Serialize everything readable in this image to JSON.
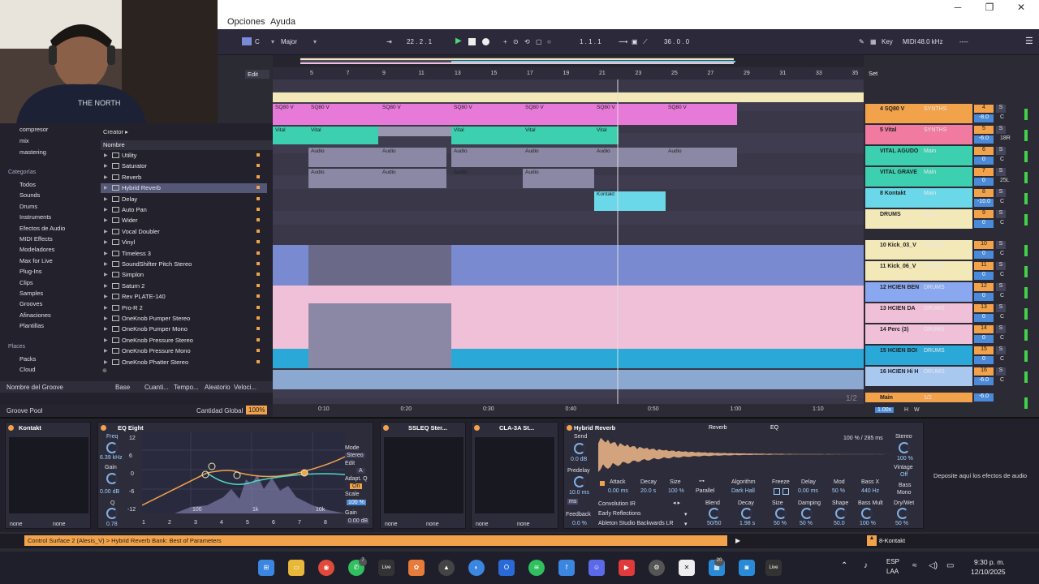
{
  "menu": {
    "opciones": "Opciones",
    "ayuda": "Ayuda"
  },
  "window_controls": {
    "min": "─",
    "max": "❐",
    "close": "✕"
  },
  "transport": {
    "key": "C",
    "scale": "Major",
    "position": "22 .  2 .  1",
    "loop_start": "1 .  1 .  1",
    "loop_len": "36 .  0 .  0",
    "key_label": "Key",
    "midi_label": "MIDI",
    "sample_rate": "48.0 kHz",
    "cpu": "----"
  },
  "browser": {
    "edit_label": "Edit",
    "places_top": [
      "compresor",
      "mix",
      "mastering"
    ],
    "categories_title": "Categorías",
    "categories": [
      "Todos",
      "Sounds",
      "Drums",
      "Instruments",
      "Efectos de Audio",
      "MIDI Effects",
      "Modeladores",
      "Max for Live",
      "Plug-Ins",
      "Clips",
      "Samples",
      "Grooves",
      "Afinaciones",
      "Plantillas"
    ],
    "places_title": "Places",
    "places": [
      "Packs",
      "Cloud"
    ],
    "creator": "Creator ▸",
    "nombre": "Nombre",
    "items": [
      "Utility",
      "Saturator",
      "Reverb",
      "Hybrid Reverb",
      "Delay",
      "Auto Pan",
      "Wider",
      "Vocal Doubler",
      "Vinyl",
      "Timeless 3",
      "SoundShifter Pitch Stereo",
      "Simplon",
      "Saturn 2",
      "Rev PLATE-140",
      "Pro-R 2",
      "OneKnob Pumper Stereo",
      "OneKnob Pumper Mono",
      "OneKnob Pressure Stereo",
      "OneKnob Pressure Mono",
      "OneKnob Phatter Stereo"
    ],
    "groove_cols": [
      "Nombre del Groove",
      "Base",
      "Cuanti...",
      "Tempo...",
      "Aleatorio",
      "Veloci..."
    ],
    "groove_pool": "Groove Pool",
    "cantidad_global": "Cantidad Global",
    "cantidad_value": "100%"
  },
  "ruler": {
    "bars": [
      "5",
      "7",
      "9",
      "11",
      "13",
      "15",
      "17",
      "19",
      "21",
      "23",
      "25",
      "27",
      "29",
      "31",
      "33",
      "35"
    ],
    "set_label": "Set"
  },
  "timeline": {
    "times": [
      "0:10",
      "0:20",
      "0:30",
      "0:40",
      "0:50",
      "1:00",
      "1:10"
    ],
    "page": "1/2"
  },
  "clips": {
    "sq80": "SQ80 V",
    "vital": "Vital",
    "audio": "Audio",
    "kontakt": "Kontakt"
  },
  "tracks": [
    {
      "name": "4 SQ80 V",
      "route": "SYNTHS",
      "num": "4",
      "vol": "-8.0",
      "pan": "C",
      "color": "#f2a24a"
    },
    {
      "name": "5 Vital",
      "route": "SYNTHS",
      "num": "5",
      "vol": "-6.0",
      "pan": "18R",
      "color": "#f07aa0"
    },
    {
      "name": "VITAL AGUDO",
      "route": "Main",
      "num": "6",
      "vol": "0",
      "pan": "C",
      "color": "#3ccfb0"
    },
    {
      "name": "VITAL GRAVE",
      "route": "Main",
      "num": "7",
      "vol": "0",
      "pan": "25L",
      "color": "#3ccfb0"
    },
    {
      "name": "8 Kontakt",
      "route": "Main",
      "num": "8",
      "vol": "-10.0",
      "pan": "C",
      "color": "#6ad8e8"
    },
    {
      "name": "DRUMS",
      "route": "Main",
      "num": "9",
      "vol": "0",
      "pan": "C",
      "color": "#f2e8b8"
    },
    {
      "name": "10 Kick_03_V",
      "route": "DRUMS",
      "num": "10",
      "vol": "0",
      "pan": "C",
      "color": "#f2e8b8"
    },
    {
      "name": "11 Kick_06_V",
      "route": "DRUMS",
      "num": "11",
      "vol": "0",
      "pan": "C",
      "color": "#f2e8b8"
    },
    {
      "name": "12 HCIEN BEN",
      "route": "DRUMS",
      "num": "12",
      "vol": "0",
      "pan": "C",
      "color": "#8aa8f0"
    },
    {
      "name": "13 HCIEN DA",
      "route": "DRUMS",
      "num": "13",
      "vol": "0",
      "pan": "C",
      "color": "#f0c0d8"
    },
    {
      "name": "14 Perc (3)",
      "route": "DRUMS",
      "num": "14",
      "vol": "0",
      "pan": "C",
      "color": "#f0c0d8"
    },
    {
      "name": "15 HCIEN BOI",
      "route": "DRUMS",
      "num": "15",
      "vol": "0",
      "pan": "C",
      "color": "#2aa8d8"
    },
    {
      "name": "16 HCIEN Hi H",
      "route": "DRUMS",
      "num": "16",
      "vol": "-6.0",
      "pan": "C",
      "color": "#a8c8f0"
    },
    {
      "name": "Main",
      "route": "1/2",
      "num": "",
      "vol": "-6.0",
      "pan": "",
      "color": "#f2a24a"
    }
  ],
  "main_extra": {
    "zoom": "1.00x",
    "h": "H",
    "w": "W"
  },
  "devices": {
    "kontakt": {
      "title": "Kontakt",
      "none1": "none",
      "none2": "none"
    },
    "eq": {
      "title": "EQ Eight",
      "freq": "Freq",
      "freq_val": "6.39 kHz",
      "gain": "Gain",
      "gain_val": "0.00 dB",
      "q": "Q",
      "q_val": "0.78",
      "db": [
        "12",
        "6",
        "0",
        "-6",
        "-12"
      ],
      "mode": "Mode",
      "mode_val": "Stereo",
      "edit": "Edit",
      "edit_val": "A",
      "adapt": "Adapt. Q",
      "adapt_val": "On",
      "scale": "Scale",
      "scale_val": "100 %",
      "gain2": "Gain",
      "gain2_val": "0.00 dB",
      "freq_labels": [
        "100",
        "1k",
        "10k"
      ],
      "bands": [
        "1",
        "2",
        "3",
        "4",
        "5",
        "6",
        "7",
        "8"
      ]
    },
    "ssleq": {
      "title": "SSLEQ Ster...",
      "none1": "none",
      "none2": "none"
    },
    "cla": {
      "title": "CLA-3A St...",
      "none1": "none",
      "none2": "none"
    },
    "hybrid": {
      "title": "Hybrid Reverb",
      "tab_reverb": "Reverb",
      "tab_eq": "EQ",
      "send": "Send",
      "send_val": "0.0 dB",
      "predelay": "Predelay",
      "predelay_val": "10.0 ms",
      "ms": "ms",
      "feedback": "Feedback",
      "feedback_val": "0.0 %",
      "ir_readout": "100 % / 285 ms",
      "attack": "Attack",
      "attack_val": "0.00 ms",
      "decay": "Decay",
      "decay_val": "20.0 s",
      "size": "Size",
      "size_val": "100 %",
      "parallel": "Parallel",
      "algorithm": "Algorithm",
      "algorithm_val": "Dark Hall",
      "freeze": "Freeze",
      "delay": "Delay",
      "delay_val": "0.00 ms",
      "mod": "Mod",
      "mod_val": "50 %",
      "bassx": "Bass X",
      "bassx_val": "440 Hz",
      "conv": "Convolution IR",
      "early": "Early Reflections",
      "ir_name": "Ableton Studio Backwards LR",
      "blend": "Blend",
      "blend_val": "50/50",
      "decay2": "Decay",
      "decay2_val": "1.98 s",
      "size2": "Size",
      "size2_val": "50 %",
      "damping": "Damping",
      "damping_val": "50 %",
      "shape": "Shape",
      "shape_val": "50.0",
      "bassmult": "Bass Mult",
      "bassmult_val": "100 %",
      "drywet": "Dry/Wet",
      "drywet_val": "50 %",
      "stereo": "Stereo",
      "stereo_val": "100 %",
      "vintage": "Vintage",
      "vintage_val": "Off",
      "bass": "Bass",
      "bass_val": "Mono"
    },
    "drop_hint": "Deposite aquí los efectos de audio"
  },
  "status": {
    "message": "Control Surface 2 (Alesis_V) > Hybrid Reverb Bank: Best of Parameters",
    "track": "8-Kontakt"
  },
  "taskbar": {
    "lang": "ESP",
    "lang2": "LAA",
    "time": "9:30 p. m.",
    "date": "12/10/2025",
    "badge_whatsapp": "7",
    "badge_teams": "20",
    "live1": "Live",
    "live2": "Live"
  }
}
